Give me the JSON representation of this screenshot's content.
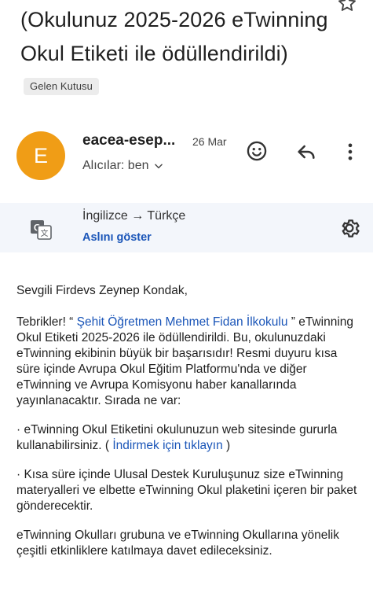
{
  "subject": {
    "text": "(Okulunuz 2025-2026 eTwinning Okul Etiketi ile ödüllendirildi)",
    "label": "Gelen Kutusu"
  },
  "icons": {
    "star": "star-icon",
    "emoji": "emoji-icon",
    "reply": "reply-icon",
    "more": "more-vert-icon",
    "translate": "translate-icon",
    "settings": "gear-icon",
    "chevron": "chevron-down-icon"
  },
  "colors": {
    "avatar": "#f09d16",
    "link": "#1a55b8",
    "translate_bar": "#f3f6fb"
  },
  "header": {
    "avatar_letter": "E",
    "sender": "eacea-esep...",
    "date": "26 Mar",
    "recipients": "Alıcılar: ben"
  },
  "translation": {
    "languages": "İngilizce → Türkçe",
    "show_original": "Aslını göster"
  },
  "body": {
    "greeting": "Sevgili Firdevs Zeynep Kondak,",
    "p1_prefix": "Tebrikler! “ ",
    "p1_link": "Şehit Öğretmen Mehmet Fidan İlkokulu",
    "p1_suffix": " ” eTwinning Okul Etiketi 2025-2026 ile ödüllendirildi. Bu, okulunuzdaki eTwinning ekibinin büyük bir başarısıdır! Resmi duyuru kısa süre içinde Avrupa Okul Eğitim Platformu'nda ve diğer eTwinning ve Avrupa Komisyonu haber kanallarında yayınlanacaktır. Sırada ne var:",
    "p2_prefix": "· eTwinning Okul Etiketini okulunuzun web sitesinde gururla kullanabilirsiniz. ( ",
    "p2_link": "İndirmek için tıklayın",
    "p2_suffix": " )",
    "p3": "· Kısa süre içinde Ulusal Destek Kuruluşunuz size eTwinning materyalleri ve elbette eTwinning Okul plaketini içeren bir paket gönderecektir.",
    "p4": "eTwinning Okulları grubuna ve eTwinning Okullarına yönelik çeşitli etkinliklere katılmaya davet edileceksiniz."
  }
}
